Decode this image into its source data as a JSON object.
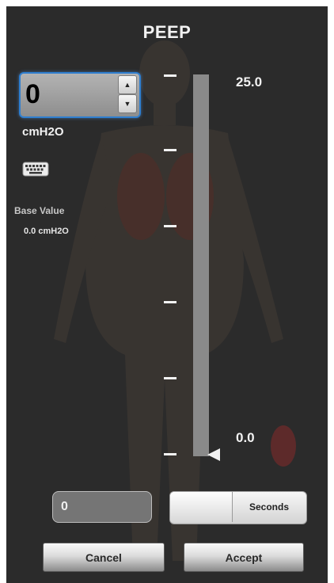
{
  "dialog": {
    "title": "PEEP"
  },
  "value_input": {
    "value": "0",
    "unit": "cmH2O"
  },
  "base": {
    "heading": "Base Value",
    "value": "0.0 cmH2O"
  },
  "slider": {
    "max_label": "25.0",
    "min_label": "0.0",
    "min": 0,
    "max": 25,
    "current": 0
  },
  "duration": {
    "value": "0",
    "unit_label": "Seconds"
  },
  "buttons": {
    "cancel": "Cancel",
    "accept": "Accept"
  },
  "icons": {
    "keyboard": "keyboard-icon",
    "spin_up": "arrow-up-icon",
    "spin_down": "arrow-down-icon",
    "slider_thumb": "triangle-pointer-icon"
  },
  "colors": {
    "panel_bg": "#2b2b2b",
    "focus_border": "#2f7fd0",
    "text": "#f2f2f2"
  }
}
